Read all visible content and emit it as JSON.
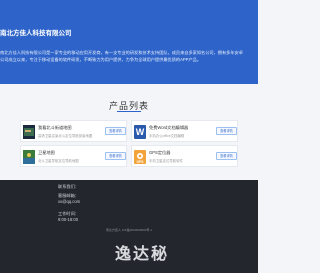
{
  "hero": {
    "title": "南北方佳人科技有限公司",
    "paragraphs": [
      "南北方佳人科技有限公司是一家专业的移动应用开发商，有一支专业的研发和技术支持团队，成员来自多家知名公司，拥有多年安卓",
      "公司成立以来，专注于移动设备的软件研发，不断致力为用户提供，力争为全球用户提供最优质的APP产品。"
    ]
  },
  "section": {
    "title": "产品列表"
  },
  "products": [
    {
      "name": "我看北斗街道地图",
      "desc": "高清卫星实景北斗定位导航街景地图",
      "button": "查看详情"
    },
    {
      "name": "免费Word文档编辑器",
      "desc": "手机办公office文档编辑",
      "button": "查看详情"
    },
    {
      "name": "卫星地图",
      "desc": "北斗卫星导航定位导航地图",
      "button": "查看详情"
    },
    {
      "name": "GPS定位器",
      "desc": "手机卫星定位导航软件",
      "button": "查看详情"
    }
  ],
  "footer": {
    "contact_label": "联系我们：",
    "email_label": "客服邮箱：",
    "email": "xx@qq.com",
    "hours_label": "工作时间：",
    "hours": "9:00-18:00",
    "copyright": "南北方佳人 ICP备2020000000号-1"
  },
  "watermark": "逸达秘"
}
